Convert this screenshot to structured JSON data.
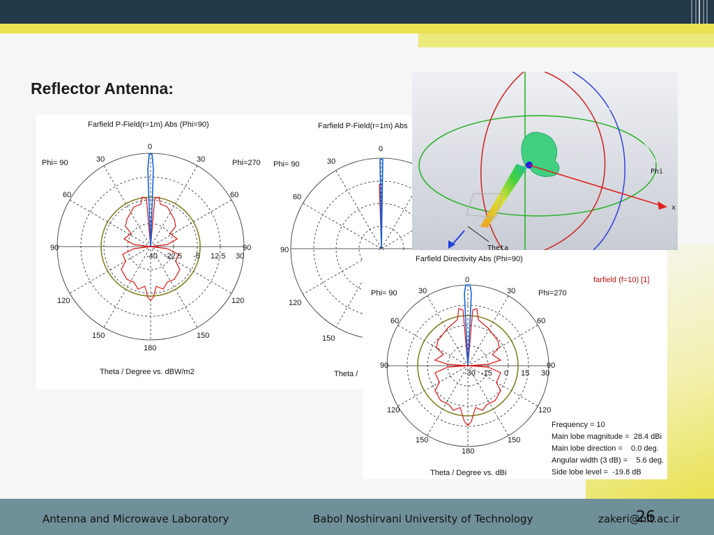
{
  "slide": {
    "title": "Reflector Antenna:",
    "page_number": "26"
  },
  "footer": {
    "left": "Antenna and Microwave Laboratory",
    "center": "Babol Noshirvani University of Technology",
    "right": "zakeri@nit.ac.ir"
  },
  "plot1": {
    "title": "Farfield P-Field(r=1m) Abs (Phi=90)",
    "left_label": "Phi= 90",
    "right_label": "Phi=270",
    "angles": {
      "a0": "0",
      "a30l": "30",
      "a30r": "30",
      "a60l": "60",
      "a60r": "60",
      "a90l": "90",
      "a90r": "90",
      "a120l": "120",
      "a120r": "120",
      "a150l": "150",
      "a150r": "150",
      "a180": "180"
    },
    "radial_ticks": [
      "-40",
      "-22.5",
      "-5",
      "12.5",
      "30"
    ],
    "xlabel": "Theta / Degree vs. dBW/m2"
  },
  "plot2": {
    "title": "Farfield P-Field(r=1m) Abs",
    "left_label": "Phi= 90",
    "angles": {
      "a0": "0",
      "a30l": "30",
      "a60l": "60",
      "a90l": "90",
      "a120l": "120",
      "a150l": "150"
    },
    "xlabel": "Theta /"
  },
  "plot3d": {
    "axis_phi": "Phi",
    "axis_theta": "Theta",
    "axis_x": "x"
  },
  "plot3": {
    "title": "Farfield Directivity Abs (Phi=90)",
    "legend": "farfield (f=10) [1]",
    "left_label": "Phi= 90",
    "right_label": "Phi=270",
    "angles": {
      "a0": "0",
      "a30l": "30",
      "a30r": "30",
      "a60l": "60",
      "a60r": "60",
      "a90l": "90",
      "a90r": "90",
      "a120l": "120",
      "a120r": "120",
      "a150l": "150",
      "a150r": "150",
      "a180": "180"
    },
    "radial_ticks": [
      "-30",
      "-15",
      "0",
      "15",
      "30"
    ],
    "xlabel": "Theta / Degree vs. dBi",
    "stats": [
      "Frequency = 10",
      "Main lobe magnitude =  28.4 dBi",
      "Main lobe direction =    0.0 deg.",
      "Angular width (3 dB) =    5.6 deg.",
      "Side lobe level =  -19.8 dB"
    ]
  },
  "colors": {
    "topbar": "#22394a",
    "accent_yellow": "#e8e251",
    "footer": "#6f8f99",
    "pattern_red": "#e01010",
    "pattern_blue": "#1060e0",
    "ring_olive": "#808020"
  }
}
